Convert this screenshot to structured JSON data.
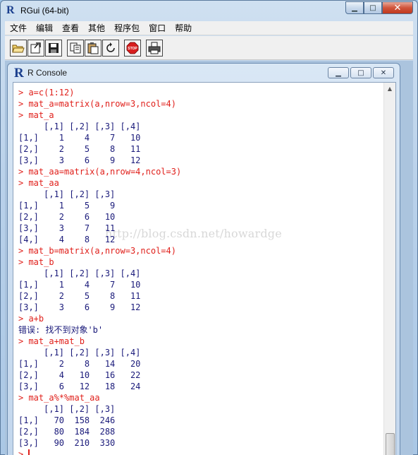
{
  "app": {
    "title": "RGui (64-bit)",
    "icon": "R",
    "minimize": "▁",
    "maximize": "□",
    "close": "✕"
  },
  "menu": [
    "文件",
    "编辑",
    "查看",
    "其他",
    "程序包",
    "窗口",
    "帮助"
  ],
  "toolbar": {
    "buttons": [
      "open-script-icon",
      "load-workspace-icon",
      "save-icon",
      "copy-icon",
      "paste-icon",
      "copy-paste-icon",
      "stop-icon",
      "print-icon"
    ],
    "stop_label": "STOP"
  },
  "console": {
    "title": "R Console",
    "icon": "R",
    "minimize": "▁",
    "maximize": "□",
    "close": "✕",
    "watermark": "http://blog.csdn.net/howardge",
    "lines": [
      {
        "type": "cmd",
        "text": "> a=c(1:12)"
      },
      {
        "type": "cmd",
        "text": "> mat_a=matrix(a,nrow=3,ncol=4)"
      },
      {
        "type": "cmd",
        "text": "> mat_a"
      },
      {
        "type": "out",
        "text": "     [,1] [,2] [,3] [,4]"
      },
      {
        "type": "out",
        "text": "[1,]    1    4    7   10"
      },
      {
        "type": "out",
        "text": "[2,]    2    5    8   11"
      },
      {
        "type": "out",
        "text": "[3,]    3    6    9   12"
      },
      {
        "type": "cmd",
        "text": "> mat_aa=matrix(a,nrow=4,ncol=3)"
      },
      {
        "type": "cmd",
        "text": "> mat_aa"
      },
      {
        "type": "out",
        "text": "     [,1] [,2] [,3]"
      },
      {
        "type": "out",
        "text": "[1,]    1    5    9"
      },
      {
        "type": "out",
        "text": "[2,]    2    6   10"
      },
      {
        "type": "out",
        "text": "[3,]    3    7   11"
      },
      {
        "type": "out",
        "text": "[4,]    4    8   12"
      },
      {
        "type": "cmd",
        "text": "> mat_b=matrix(a,nrow=3,ncol=4)"
      },
      {
        "type": "cmd",
        "text": "> mat_b"
      },
      {
        "type": "out",
        "text": "     [,1] [,2] [,3] [,4]"
      },
      {
        "type": "out",
        "text": "[1,]    1    4    7   10"
      },
      {
        "type": "out",
        "text": "[2,]    2    5    8   11"
      },
      {
        "type": "out",
        "text": "[3,]    3    6    9   12"
      },
      {
        "type": "cmd",
        "text": "> a+b"
      },
      {
        "type": "err",
        "text": "错误: 找不到对象'b'"
      },
      {
        "type": "cmd",
        "text": "> mat_a+mat_b"
      },
      {
        "type": "out",
        "text": "     [,1] [,2] [,3] [,4]"
      },
      {
        "type": "out",
        "text": "[1,]    2    8   14   20"
      },
      {
        "type": "out",
        "text": "[2,]    4   10   16   22"
      },
      {
        "type": "out",
        "text": "[3,]    6   12   18   24"
      },
      {
        "type": "cmd",
        "text": "> mat_a%*%mat_aa"
      },
      {
        "type": "out",
        "text": "     [,1] [,2] [,3]"
      },
      {
        "type": "out",
        "text": "[1,]   70  158  246"
      },
      {
        "type": "out",
        "text": "[2,]   80  184  288"
      },
      {
        "type": "out",
        "text": "[3,]   90  210  330"
      }
    ],
    "prompt": ">",
    "scroll_up": "▲"
  }
}
